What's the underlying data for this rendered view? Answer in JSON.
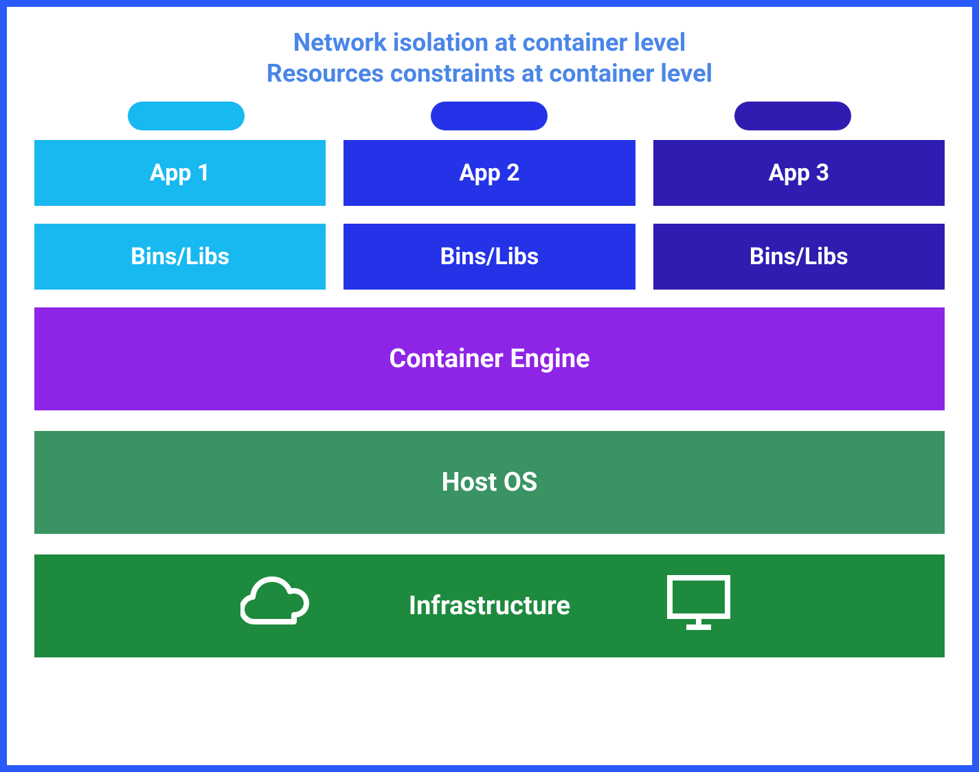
{
  "header": {
    "line1": "Network isolation at container level",
    "line2": "Resources constraints at container level"
  },
  "columns": [
    {
      "pill_color": "#18b8f1",
      "app_color": "#18b8f1",
      "bins_color": "#18b8f1",
      "app_label": "App 1",
      "bins_label": "Bins/Libs"
    },
    {
      "pill_color": "#2432e8",
      "app_color": "#2432e8",
      "bins_color": "#2432e8",
      "app_label": "App 2",
      "bins_label": "Bins/Libs"
    },
    {
      "pill_color": "#2f1db1",
      "app_color": "#2f1db1",
      "bins_color": "#2f1db1",
      "app_label": "App 3",
      "bins_label": "Bins/Libs"
    }
  ],
  "layers": {
    "container_engine": {
      "label": "Container Engine",
      "color": "#8e24e6"
    },
    "host_os": {
      "label": "Host OS",
      "color": "#3a9363"
    },
    "infrastructure": {
      "label": "Infrastructure",
      "color": "#1e8a3e"
    }
  },
  "icons": {
    "cloud": "cloud-icon",
    "monitor": "monitor-icon"
  }
}
